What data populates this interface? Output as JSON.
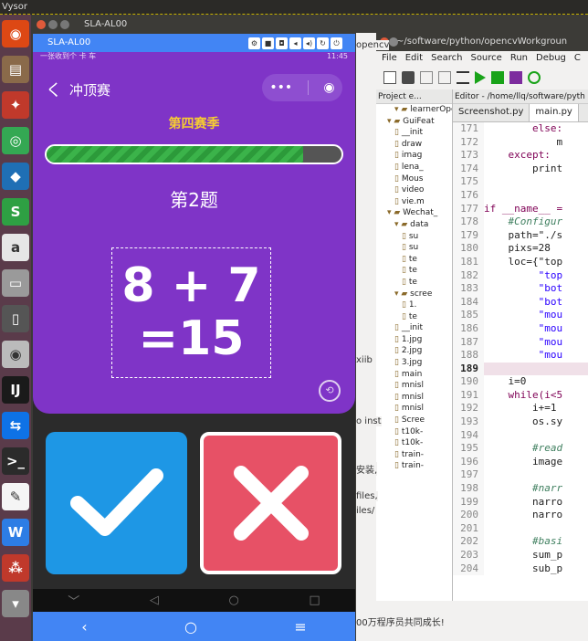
{
  "desktop": {
    "topbar_title": "Vysor"
  },
  "launcher": {
    "items": [
      {
        "icon": "ubuntu-icon",
        "glyph": "◉",
        "color": "#dd4814"
      },
      {
        "icon": "files-icon",
        "glyph": "▤",
        "color": "#8a6a4a"
      },
      {
        "icon": "network-icon",
        "glyph": "✦",
        "color": "#c0392b"
      },
      {
        "icon": "chrome-icon",
        "glyph": "◎",
        "color": "#34a853"
      },
      {
        "icon": "virtualbox-icon",
        "glyph": "◆",
        "color": "#1f6fb5"
      },
      {
        "icon": "sublime-icon",
        "glyph": "S",
        "color": "#2ea043"
      },
      {
        "icon": "amazon-icon",
        "glyph": "a",
        "color": "#e6e6e6"
      },
      {
        "icon": "disk-icon",
        "glyph": "▭",
        "color": "#9a9a9a"
      },
      {
        "icon": "phone-icon",
        "glyph": "▯",
        "color": "#555"
      },
      {
        "icon": "dvd-icon",
        "glyph": "◉",
        "color": "#bbb"
      },
      {
        "icon": "intellij-icon",
        "glyph": "IJ",
        "color": "#1a1a1a"
      },
      {
        "icon": "teamviewer-icon",
        "glyph": "⇆",
        "color": "#0e72e6"
      },
      {
        "icon": "terminal-icon",
        "glyph": ">_",
        "color": "#2b2b2b"
      },
      {
        "icon": "editor-icon",
        "glyph": "✎",
        "color": "#f5f5f5"
      },
      {
        "icon": "wps-icon",
        "glyph": "W",
        "color": "#2d7de5"
      },
      {
        "icon": "app-grid-icon",
        "glyph": "⁂",
        "color": "#c0392b"
      },
      {
        "icon": "trash-icon",
        "glyph": "▾",
        "color": "#888"
      }
    ]
  },
  "ide": {
    "title": "~/software/python/opencvWorkgroun",
    "menu": [
      "File",
      "Edit",
      "Search",
      "Source",
      "Run",
      "Debug",
      "C"
    ],
    "project_header": "Project e...",
    "editor_header": "Editor - /home/llq/software/pyth",
    "tabs": [
      "Screenshot.py",
      "main.py"
    ],
    "tree": [
      "learnerOpe",
      "GuiFeat",
      "__init",
      "draw",
      "imag",
      "lena_",
      "Mous",
      "video",
      "vie.m",
      "Wechat_",
      "data",
      "su",
      "su",
      "te",
      "te",
      "te",
      "scree",
      "1.",
      "te",
      "__init",
      "1.jpg",
      "2.jpg",
      "3.jpg",
      "main",
      "mnisl",
      "mnisl",
      "mnisl",
      "Scree",
      "t10k-",
      "t10k-",
      "train-",
      "train-"
    ],
    "code": [
      {
        "n": "171",
        "t": "        else:"
      },
      {
        "n": "172",
        "t": "            m"
      },
      {
        "n": "173",
        "t": "    except:"
      },
      {
        "n": "174",
        "t": "        print"
      },
      {
        "n": "175",
        "t": ""
      },
      {
        "n": "176",
        "t": ""
      },
      {
        "n": "177",
        "t": "if __name__ ="
      },
      {
        "n": "178",
        "t": "    #Configur"
      },
      {
        "n": "179",
        "t": "    path=\"./s"
      },
      {
        "n": "180",
        "t": "    pixs=28"
      },
      {
        "n": "181",
        "t": "    loc={\"top"
      },
      {
        "n": "182",
        "t": "         \"top"
      },
      {
        "n": "183",
        "t": "         \"bot"
      },
      {
        "n": "184",
        "t": "         \"bot"
      },
      {
        "n": "185",
        "t": "         \"mou"
      },
      {
        "n": "186",
        "t": "         \"mou"
      },
      {
        "n": "187",
        "t": "         \"mou"
      },
      {
        "n": "188",
        "t": "         \"mou"
      },
      {
        "n": "189",
        "t": ""
      },
      {
        "n": "190",
        "t": "    i=0"
      },
      {
        "n": "191",
        "t": "    while(i<5"
      },
      {
        "n": "192",
        "t": "        i+=1"
      },
      {
        "n": "193",
        "t": "        os.sy"
      },
      {
        "n": "194",
        "t": ""
      },
      {
        "n": "195",
        "t": "        #read"
      },
      {
        "n": "196",
        "t": "        image"
      },
      {
        "n": "197",
        "t": ""
      },
      {
        "n": "198",
        "t": "        #narr"
      },
      {
        "n": "199",
        "t": "        narro"
      },
      {
        "n": "200",
        "t": "        narro"
      },
      {
        "n": "201",
        "t": ""
      },
      {
        "n": "202",
        "t": "        #basi"
      },
      {
        "n": "203",
        "t": "        sum_p"
      },
      {
        "n": "204",
        "t": "        sub_p"
      }
    ],
    "current_line": "189"
  },
  "web_fragments": {
    "a": "opencv",
    "b": "xiib",
    "c": "o inst",
    "d": "安装,",
    "e": "files,",
    "f": "iles/",
    "g": "00万程序员共同成长!"
  },
  "phone": {
    "window_title": "SLA-AL00",
    "device_name": "SLA-AL00",
    "status_left": "一张收到个 卡 车",
    "status_right": "11:45",
    "nav_back": "く",
    "nav_title": "冲顶赛",
    "capsule_more": "•••",
    "capsule_close": "◉",
    "season": "第四赛季",
    "progress": 0.87,
    "question_number": "第2题",
    "formula_line1": "8 + 7",
    "formula_line2": "=15",
    "sys_nav": [
      "﹀",
      "◁",
      "○",
      "□"
    ],
    "bottom_nav": [
      "‹",
      "○",
      "≡"
    ],
    "colors": {
      "purple": "#7f34c7",
      "yes": "#1e97e5",
      "no": "#e75166",
      "season": "#f6cc32"
    }
  }
}
